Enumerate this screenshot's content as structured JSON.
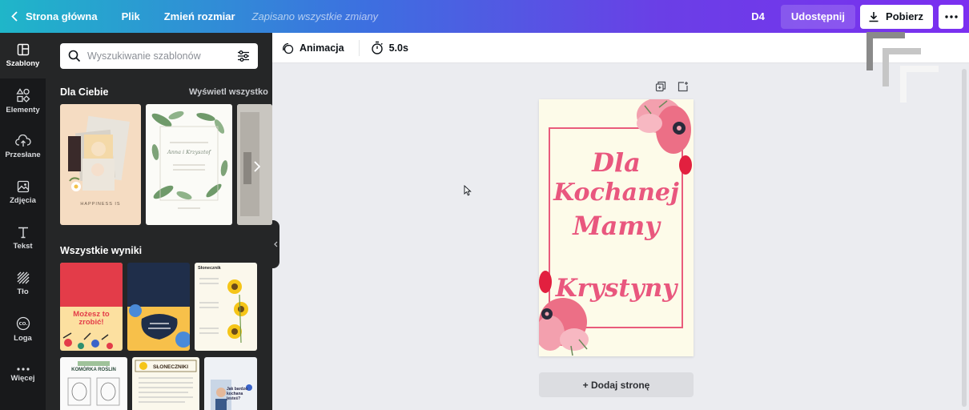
{
  "topbar": {
    "home": "Strona główna",
    "file": "Plik",
    "resize": "Zmień rozmiar",
    "saved_status": "Zapisano wszystkie zmiany",
    "design_label": "D4",
    "share": "Udostępnij",
    "download": "Pobierz"
  },
  "rail": {
    "items": [
      {
        "label": "Szablony",
        "icon": "templates-icon"
      },
      {
        "label": "Elementy",
        "icon": "elements-icon"
      },
      {
        "label": "Przesłane",
        "icon": "upload-icon"
      },
      {
        "label": "Zdjęcia",
        "icon": "photos-icon"
      },
      {
        "label": "Tekst",
        "icon": "text-icon"
      },
      {
        "label": "Tło",
        "icon": "background-icon"
      },
      {
        "label": "Loga",
        "icon": "logo-icon"
      },
      {
        "label": "Więcej",
        "icon": "more-icon"
      }
    ]
  },
  "panel": {
    "search_placeholder": "Wyszukiwanie szablonów",
    "section_for_you": "Dla Ciebie",
    "see_all": "Wyświetl wszystko",
    "section_all_results": "Wszystkie wyniki",
    "thumbs": {
      "happiness": "HAPPINESS IS",
      "wedding": "Anna i Krzysztof",
      "motivation": "Możesz to zrobić!",
      "sunflower": "Słonecznik",
      "plant_cell": "KOMÓRKA ROŚLIN",
      "sunflowers_upper": "SŁONECZNIKI",
      "loved_mom": "Jak bardzo kochana jesteś?"
    }
  },
  "toolbar": {
    "animation": "Animacja",
    "duration": "5.0s"
  },
  "canvas": {
    "line1": "Dla",
    "line2": "Kochanej",
    "line3": "Mamy",
    "line4": "Krystyny",
    "add_page": "+ Dodaj stronę"
  },
  "colors": {
    "accent_pink": "#e9577e",
    "panel_dark": "#252627",
    "rail_dark": "#18191b"
  }
}
